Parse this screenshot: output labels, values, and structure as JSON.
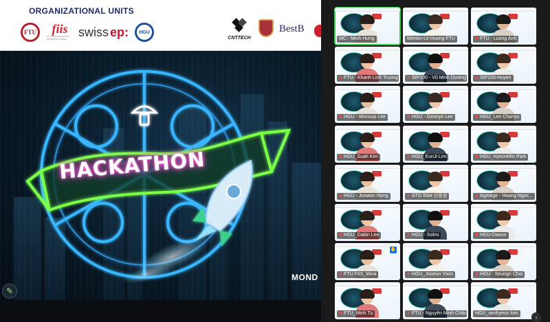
{
  "banner": {
    "title": "ORGANIZATIONAL UNITS",
    "logos": {
      "ftu": "FTU",
      "fiis": "fiis",
      "fiis_sub": "FTU INNOVATION AND INCUBATION SPACE",
      "swiss": "swiss",
      "swiss_ep": "ep:",
      "hcmut": "HGU",
      "cnttech": "CNTTECH",
      "bestb": "BestB"
    }
  },
  "poster": {
    "headline": "HACKATHON",
    "date_text": "MOND"
  },
  "colors": {
    "neon_blue": "#38b6ff",
    "neon_green": "#7cff4a",
    "neon_pink": "#ff4fd8",
    "speaker_outline": "#2fd24a"
  },
  "gallery": {
    "participants": [
      {
        "name": "MC - Minh Hưng",
        "muted": false,
        "active_speaker": true
      },
      {
        "name": "Mentor-Le Huong FTU",
        "muted": false,
        "active_speaker": false
      },
      {
        "name": "FTU - Luong Anh",
        "muted": true,
        "active_speaker": false
      },
      {
        "name": "FTU - Khanh Linh Truong",
        "muted": true,
        "active_speaker": false
      },
      {
        "name": "SIP100 - Vũ Minh Dương",
        "muted": true,
        "active_speaker": false
      },
      {
        "name": "SIP100-Huyen",
        "muted": true,
        "active_speaker": false
      },
      {
        "name": "HGU - Wonsup Lee",
        "muted": true,
        "active_speaker": false
      },
      {
        "name": "HGU - Geonyo Lee",
        "muted": true,
        "active_speaker": false
      },
      {
        "name": "HGU_Lee Chanyu",
        "muted": true,
        "active_speaker": false
      },
      {
        "name": "HGU_Suah Kim",
        "muted": true,
        "active_speaker": false
      },
      {
        "name": "HGU_EunJi Lim",
        "muted": true,
        "active_speaker": false
      },
      {
        "name": "HGU_HyeonMin Park",
        "muted": true,
        "active_speaker": false
      },
      {
        "name": "HGU - Joowon Hong",
        "muted": true,
        "active_speaker": false
      },
      {
        "name": "STG Eliot 신동원",
        "muted": true,
        "active_speaker": false
      },
      {
        "name": "Agritage - Hoang Ngoc...",
        "muted": true,
        "active_speaker": false
      },
      {
        "name": "HGU_Dabin Lee",
        "muted": true,
        "active_speaker": false
      },
      {
        "name": "HGU - Solmi",
        "muted": true,
        "active_speaker": false
      },
      {
        "name": "HGU-Daeun",
        "muted": true,
        "active_speaker": false
      },
      {
        "name": "FTU FIIS_Mina",
        "muted": true,
        "active_speaker": false
      },
      {
        "name": "HGU_Jooeun Yoon",
        "muted": true,
        "active_speaker": false
      },
      {
        "name": "HGU - Seungri Choi",
        "muted": true,
        "active_speaker": false
      },
      {
        "name": "FTU_Minh Tu",
        "muted": true,
        "active_speaker": false
      },
      {
        "name": "FTU - Nguyễn Minh Châu",
        "muted": true,
        "active_speaker": false
      },
      {
        "name": "HGU_seohyeon kim",
        "muted": false,
        "active_speaker": false
      }
    ]
  }
}
